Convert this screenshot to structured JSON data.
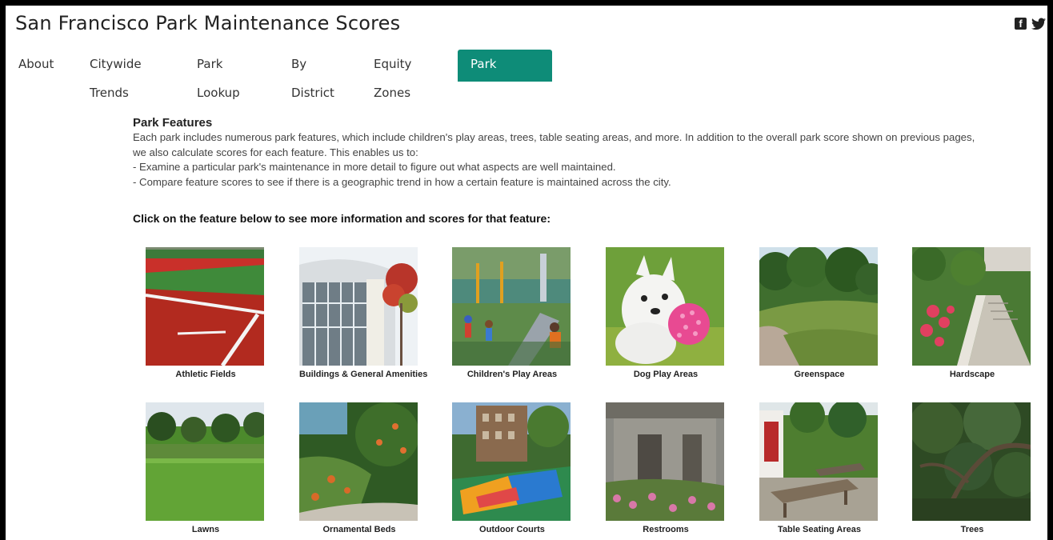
{
  "header": {
    "title": "San Francisco Park Maintenance Scores",
    "facebook_icon": "f"
  },
  "tabs": [
    {
      "label": "About"
    },
    {
      "label": "Citywide Trends"
    },
    {
      "label": "Park Lookup"
    },
    {
      "label": "By District"
    },
    {
      "label": "Equity Zones"
    },
    {
      "label": "Park Features",
      "active": true
    }
  ],
  "colors": {
    "accent": "#0e8c78"
  },
  "main": {
    "heading": "Park Features",
    "intro_line1": "Each park includes numerous park features, which include children's play areas, trees, table seating areas, and more. In addition to the overall park score shown on previous pages,",
    "intro_line2": "we also calculate scores for each feature. This enables us to:",
    "bullets": [
      " - Examine a particular park's maintenance in more detail to figure out what aspects are well maintained.",
      " - Compare feature scores to see if there is a geographic trend in how a certain feature is maintained across the city."
    ],
    "cta": "Click on the feature below to see more information and scores for that feature:"
  },
  "features": [
    {
      "label": "Athletic Fields"
    },
    {
      "label": "Buildings & General Amenities"
    },
    {
      "label": "Children's Play Areas"
    },
    {
      "label": "Dog Play Areas"
    },
    {
      "label": "Greenspace"
    },
    {
      "label": "Hardscape"
    },
    {
      "label": "Lawns"
    },
    {
      "label": "Ornamental Beds"
    },
    {
      "label": "Outdoor Courts"
    },
    {
      "label": "Restrooms"
    },
    {
      "label": "Table Seating Areas"
    },
    {
      "label": "Trees"
    }
  ]
}
